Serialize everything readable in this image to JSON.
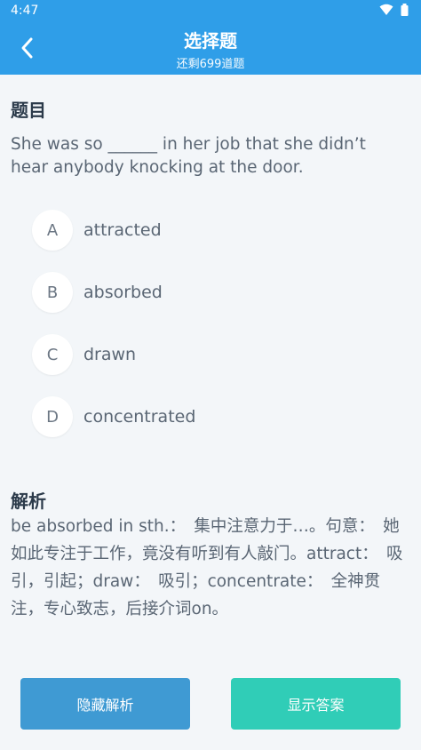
{
  "status_bar": {
    "time": "4:47"
  },
  "header": {
    "title": "选择题",
    "subtitle": "还剩699道题"
  },
  "question": {
    "heading": "题目",
    "text": "She was so ______ in her job that she didn’t hear anybody knocking at the door."
  },
  "options": [
    {
      "letter": "A",
      "text": "attracted"
    },
    {
      "letter": "B",
      "text": "absorbed"
    },
    {
      "letter": "C",
      "text": "drawn"
    },
    {
      "letter": "D",
      "text": "concentrated"
    }
  ],
  "analysis": {
    "heading": "解析",
    "text": "be absorbed in sth.：　集中注意力于…。句意：　她如此专注于工作，竟没有听到有人敲门。attract：　吸引，引起；draw：　吸引；concentrate：　全神贯注，专心致志，后接介词on。"
  },
  "buttons": {
    "hide_analysis": "隐藏解析",
    "show_answer": "显示答案"
  },
  "colors": {
    "header_bg": "#2f9ee8",
    "hide_button_bg": "#3f9ad3",
    "show_button_bg": "#30cdb7",
    "page_bg": "#f3f6f9"
  },
  "icons": {
    "back": "chevron-left-icon",
    "wifi": "wifi-icon",
    "battery": "battery-icon"
  }
}
